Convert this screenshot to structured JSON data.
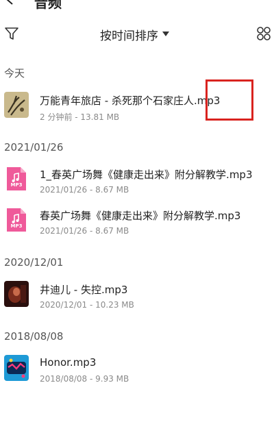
{
  "topbar": {
    "title": "音频"
  },
  "toolbar": {
    "sort_label": "按时间排序"
  },
  "sections": [
    {
      "title": "今天",
      "items": [
        {
          "name": "万能青年旅店 - 杀死那个石家庄人.mp3",
          "meta": "2 分钟前 - 13.81 MB",
          "thumb": "album-art-ink"
        }
      ]
    },
    {
      "title": "2021/01/26",
      "items": [
        {
          "name": "1_春英广场舞《健康走出来》附分解教学.mp3",
          "meta": "2021/01/26 - 8.67 MB",
          "thumb": "mp3-file-icon",
          "tag": "MP3"
        },
        {
          "name": "春英广场舞《健康走出来》附分解教学.mp3",
          "meta": "2021/01/26 - 8.67 MB",
          "thumb": "mp3-file-icon",
          "tag": "MP3"
        }
      ]
    },
    {
      "title": "2020/12/01",
      "items": [
        {
          "name": "井迪儿 - 失控.mp3",
          "meta": "2020/12/01 - 10.23 MB",
          "thumb": "album-art-dark"
        }
      ]
    },
    {
      "title": "2018/08/08",
      "items": [
        {
          "name": "Honor.mp3",
          "meta": "2018/08/08 - 9.93 MB",
          "thumb": "album-art-blue"
        }
      ]
    }
  ],
  "colors": {
    "mp3_pink": "#ef5a9a",
    "highlight_red": "#d9231f"
  }
}
